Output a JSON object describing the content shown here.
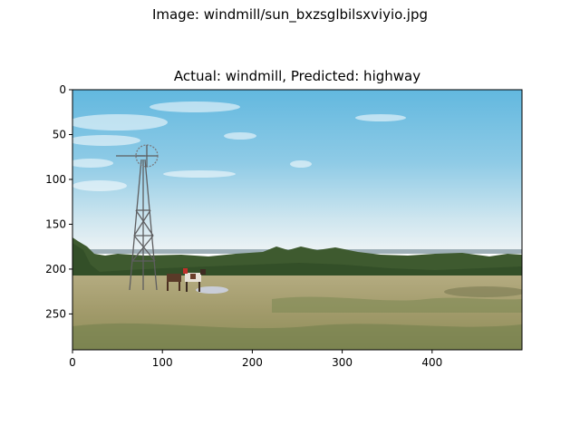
{
  "figure": {
    "suptitle": "Image: windmill/sun_bxzsglbilsxviyio.jpg",
    "axes_title": "Actual: windmill, Predicted: highway"
  },
  "image_axes": {
    "x_ticks": [
      0,
      100,
      200,
      300,
      400
    ],
    "y_ticks": [
      0,
      50,
      100,
      150,
      200,
      250
    ],
    "x_range": [
      0,
      500
    ],
    "y_range": [
      0,
      290
    ]
  },
  "photo": {
    "subject": "prairie windmill with horses near a water trough",
    "colors": {
      "sky_top": "#6bbde0",
      "sky_horizon": "#eef3f5",
      "trees": "#3d5a2e",
      "grass": "#a39a6c"
    }
  }
}
